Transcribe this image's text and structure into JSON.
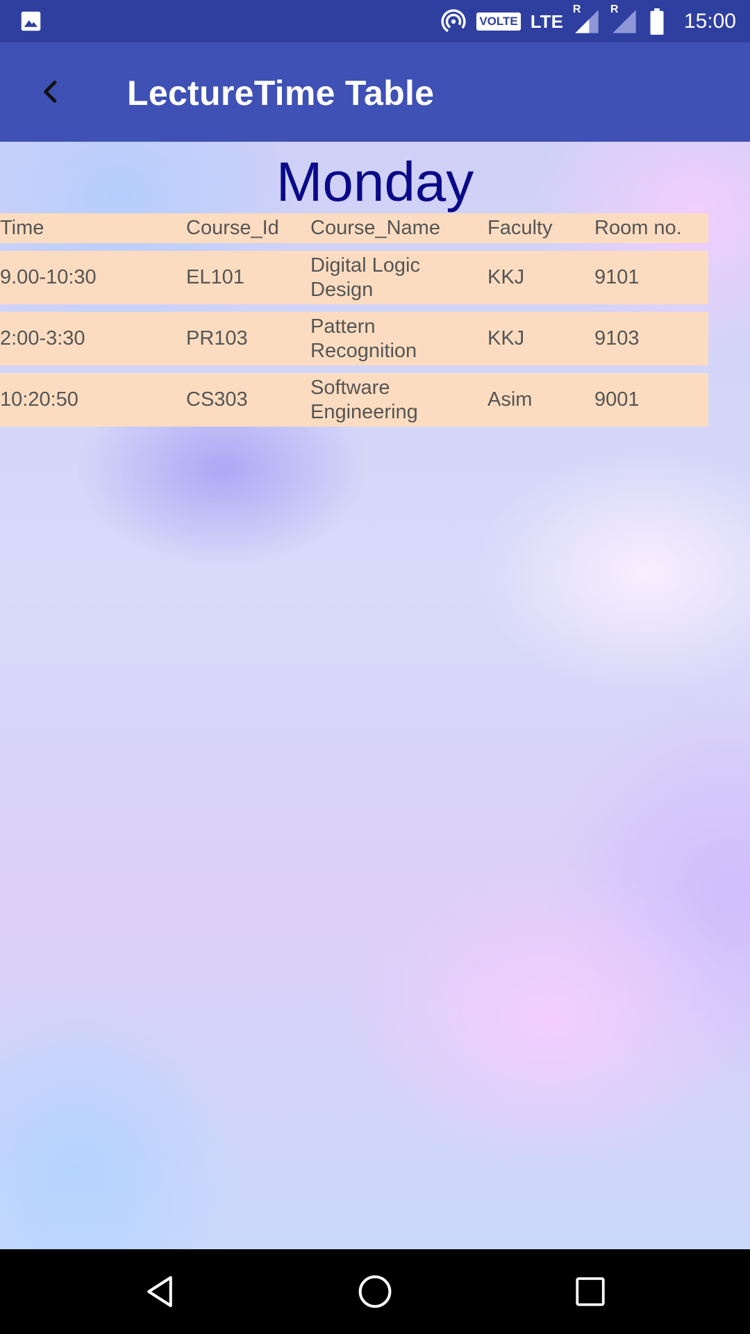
{
  "status_bar": {
    "time": "15:00",
    "volte_label": "VOLTE",
    "lte_label": "LTE",
    "roaming_1": "R",
    "roaming_2": "R",
    "icons": [
      "image-icon",
      "hotspot-icon",
      "signal-icon",
      "battery-icon"
    ]
  },
  "app_bar": {
    "title": "LectureTime Table",
    "back_icon": "back-arrow-icon"
  },
  "main": {
    "day": "Monday",
    "table": {
      "headers": [
        "Time",
        "Course_Id",
        "Course_Name",
        "Faculty",
        "Room no."
      ],
      "rows": [
        [
          "9.00-10:30",
          "EL101",
          "Digital Logic Design",
          "KKJ",
          "9101"
        ],
        [
          "2:00-3:30",
          "PR103",
          "Pattern Recognition",
          "KKJ",
          "9103"
        ],
        [
          "10:20:50",
          "CS303",
          "Software Engineering",
          "Asim",
          "9001"
        ]
      ]
    }
  },
  "nav_bar": {
    "icons": [
      "back-triangle-icon",
      "home-circle-icon",
      "recents-square-icon"
    ]
  },
  "colors": {
    "status_bar": "#2f3fa0",
    "app_bar": "#3f51b5",
    "row_bg": "#fbdcc0",
    "day_text": "#0a0a88"
  }
}
